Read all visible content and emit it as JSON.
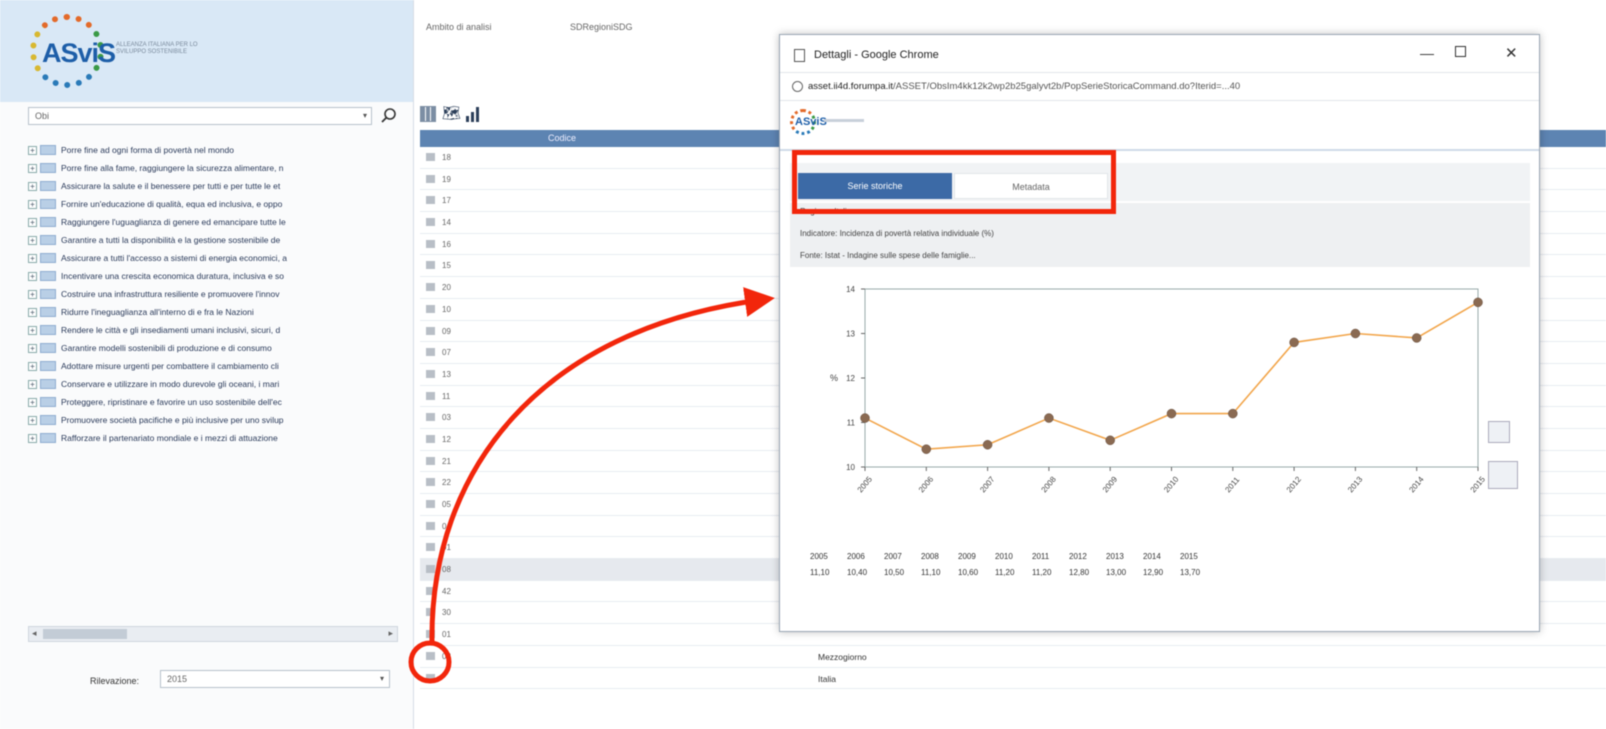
{
  "left_panel": {
    "logo_text": "ASviS",
    "logo_tagline": "ALLEANZA ITALIANA PER LO SVILUPPO SOSTENIBILE",
    "search_value": "Obi",
    "tree_items": [
      "Porre fine ad ogni forma di povertà nel mondo",
      "Porre fine alla fame, raggiungere la sicurezza alimentare, n",
      "Assicurare la salute e il benessere per tutti e per tutte le et",
      "Fornire un'educazione di qualità, equa ed inclusiva, e oppo",
      "Raggiungere l'uguaglianza di genere ed emancipare tutte le",
      "Garantire a tutti la disponibilità e la gestione sostenibile de",
      "Assicurare a tutti l'accesso a sistemi di energia economici, a",
      "Incentivare una crescita economica duratura, inclusiva e so",
      "Costruire una infrastruttura resiliente e promuovere l'innov",
      "Ridurre l'ineguaglianza all'interno di e fra le Nazioni",
      "Rendere le città e gli insediamenti umani inclusivi, sicuri, d",
      "Garantire modelli sostenibili di produzione e di consumo",
      "Adottare misure urgenti per combattere il cambiamento cli",
      "Conservare e utilizzare in modo durevole gli oceani, i mari",
      "Proteggere, ripristinare e favorire un uso sostenibile dell'ec",
      "Promuovere società pacifiche e più inclusive per uno svilup",
      "Rafforzare il partenariato mondiale e i mezzi di attuazione"
    ],
    "rilevazione_label": "Rilevazione:",
    "rilevazione_value": "2015"
  },
  "main": {
    "ambito_label": "Ambito di analisi",
    "ambito_value": "SDRegioniSDG",
    "grid_header": "Codice",
    "rows": [
      {
        "code": "18",
        "name": ""
      },
      {
        "code": "19",
        "name": ""
      },
      {
        "code": "17",
        "name": ""
      },
      {
        "code": "14",
        "name": ""
      },
      {
        "code": "16",
        "name": ""
      },
      {
        "code": "15",
        "name": ""
      },
      {
        "code": "20",
        "name": ""
      },
      {
        "code": "10",
        "name": ""
      },
      {
        "code": "09",
        "name": ""
      },
      {
        "code": "07",
        "name": ""
      },
      {
        "code": "13",
        "name": ""
      },
      {
        "code": "11",
        "name": ""
      },
      {
        "code": "03",
        "name": ""
      },
      {
        "code": "12",
        "name": ""
      },
      {
        "code": "21",
        "name": ""
      },
      {
        "code": "22",
        "name": ""
      },
      {
        "code": "05",
        "name": ""
      },
      {
        "code": "04",
        "name": ""
      },
      {
        "code": "01",
        "name": ""
      },
      {
        "code": "08",
        "name": ""
      },
      {
        "code": "42",
        "name": ""
      },
      {
        "code": "30",
        "name": ""
      },
      {
        "code": "01",
        "name": ""
      },
      {
        "code": "02",
        "name": "Mezzogiorno"
      },
      {
        "code": "",
        "name": "Italia"
      }
    ]
  },
  "popup": {
    "title": "Dettagli - Google Chrome",
    "url_host": "asset.ii4d.forumpa.it",
    "url_path": "/ASSET/ObsIm4kk12k2wp2b25galyvt2b/PopSerieStoricaCommand.do?Iterid=...40",
    "tabs": [
      "Serie storiche",
      "Metadata"
    ],
    "info_lines": [
      "Regione: Italia",
      "Indicatore: Incidenza di povertà relativa individuale (%)",
      "Fonte: Istat - Indagine sulle spese delle famiglie..."
    ],
    "table_years": [
      "2005",
      "2006",
      "2007",
      "2008",
      "2009",
      "2010",
      "2011",
      "2012",
      "2013",
      "2014",
      "2015"
    ],
    "table_values": [
      "11,10",
      "10,40",
      "10,50",
      "11,10",
      "10,60",
      "11,20",
      "11,20",
      "12,80",
      "13,00",
      "12,90",
      "13,70"
    ]
  },
  "chart_data": {
    "type": "line",
    "categories": [
      "2005",
      "2006",
      "2007",
      "2008",
      "2009",
      "2010",
      "2011",
      "2012",
      "2013",
      "2014",
      "2015"
    ],
    "series": [
      {
        "values": [
          11.1,
          10.4,
          10.5,
          11.1,
          10.6,
          11.2,
          11.2,
          12.8,
          13.0,
          12.9,
          13.7
        ]
      }
    ],
    "title": "",
    "xlabel": "",
    "ylabel": "%",
    "ylim": [
      10,
      14
    ],
    "yticks": [
      "10",
      "11",
      "12",
      "13",
      "14"
    ],
    "line_color": "#f2a54a",
    "marker_color": "#8a6a52"
  },
  "colors": {
    "accent": "#3c6aa6",
    "highlight": "#f2260b",
    "header": "#5d84b2"
  }
}
